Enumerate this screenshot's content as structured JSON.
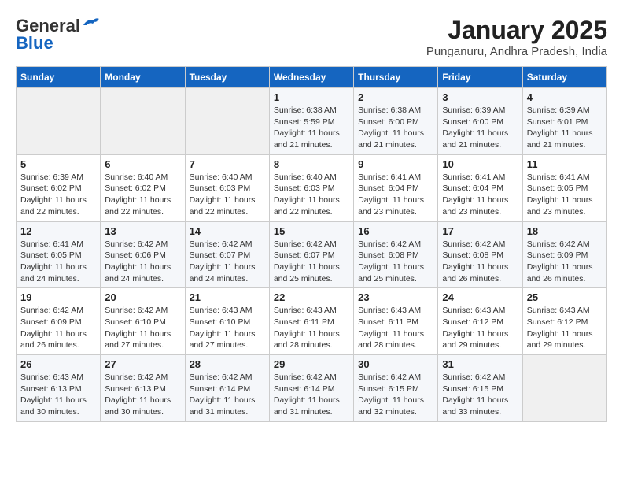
{
  "header": {
    "logo_general": "General",
    "logo_blue": "Blue",
    "month_title": "January 2025",
    "location": "Punganuru, Andhra Pradesh, India"
  },
  "weekdays": [
    "Sunday",
    "Monday",
    "Tuesday",
    "Wednesday",
    "Thursday",
    "Friday",
    "Saturday"
  ],
  "weeks": [
    [
      {
        "day": "",
        "info": ""
      },
      {
        "day": "",
        "info": ""
      },
      {
        "day": "",
        "info": ""
      },
      {
        "day": "1",
        "info": "Sunrise: 6:38 AM\nSunset: 5:59 PM\nDaylight: 11 hours and 21 minutes."
      },
      {
        "day": "2",
        "info": "Sunrise: 6:38 AM\nSunset: 6:00 PM\nDaylight: 11 hours and 21 minutes."
      },
      {
        "day": "3",
        "info": "Sunrise: 6:39 AM\nSunset: 6:00 PM\nDaylight: 11 hours and 21 minutes."
      },
      {
        "day": "4",
        "info": "Sunrise: 6:39 AM\nSunset: 6:01 PM\nDaylight: 11 hours and 21 minutes."
      }
    ],
    [
      {
        "day": "5",
        "info": "Sunrise: 6:39 AM\nSunset: 6:02 PM\nDaylight: 11 hours and 22 minutes."
      },
      {
        "day": "6",
        "info": "Sunrise: 6:40 AM\nSunset: 6:02 PM\nDaylight: 11 hours and 22 minutes."
      },
      {
        "day": "7",
        "info": "Sunrise: 6:40 AM\nSunset: 6:03 PM\nDaylight: 11 hours and 22 minutes."
      },
      {
        "day": "8",
        "info": "Sunrise: 6:40 AM\nSunset: 6:03 PM\nDaylight: 11 hours and 22 minutes."
      },
      {
        "day": "9",
        "info": "Sunrise: 6:41 AM\nSunset: 6:04 PM\nDaylight: 11 hours and 23 minutes."
      },
      {
        "day": "10",
        "info": "Sunrise: 6:41 AM\nSunset: 6:04 PM\nDaylight: 11 hours and 23 minutes."
      },
      {
        "day": "11",
        "info": "Sunrise: 6:41 AM\nSunset: 6:05 PM\nDaylight: 11 hours and 23 minutes."
      }
    ],
    [
      {
        "day": "12",
        "info": "Sunrise: 6:41 AM\nSunset: 6:05 PM\nDaylight: 11 hours and 24 minutes."
      },
      {
        "day": "13",
        "info": "Sunrise: 6:42 AM\nSunset: 6:06 PM\nDaylight: 11 hours and 24 minutes."
      },
      {
        "day": "14",
        "info": "Sunrise: 6:42 AM\nSunset: 6:07 PM\nDaylight: 11 hours and 24 minutes."
      },
      {
        "day": "15",
        "info": "Sunrise: 6:42 AM\nSunset: 6:07 PM\nDaylight: 11 hours and 25 minutes."
      },
      {
        "day": "16",
        "info": "Sunrise: 6:42 AM\nSunset: 6:08 PM\nDaylight: 11 hours and 25 minutes."
      },
      {
        "day": "17",
        "info": "Sunrise: 6:42 AM\nSunset: 6:08 PM\nDaylight: 11 hours and 26 minutes."
      },
      {
        "day": "18",
        "info": "Sunrise: 6:42 AM\nSunset: 6:09 PM\nDaylight: 11 hours and 26 minutes."
      }
    ],
    [
      {
        "day": "19",
        "info": "Sunrise: 6:42 AM\nSunset: 6:09 PM\nDaylight: 11 hours and 26 minutes."
      },
      {
        "day": "20",
        "info": "Sunrise: 6:42 AM\nSunset: 6:10 PM\nDaylight: 11 hours and 27 minutes."
      },
      {
        "day": "21",
        "info": "Sunrise: 6:43 AM\nSunset: 6:10 PM\nDaylight: 11 hours and 27 minutes."
      },
      {
        "day": "22",
        "info": "Sunrise: 6:43 AM\nSunset: 6:11 PM\nDaylight: 11 hours and 28 minutes."
      },
      {
        "day": "23",
        "info": "Sunrise: 6:43 AM\nSunset: 6:11 PM\nDaylight: 11 hours and 28 minutes."
      },
      {
        "day": "24",
        "info": "Sunrise: 6:43 AM\nSunset: 6:12 PM\nDaylight: 11 hours and 29 minutes."
      },
      {
        "day": "25",
        "info": "Sunrise: 6:43 AM\nSunset: 6:12 PM\nDaylight: 11 hours and 29 minutes."
      }
    ],
    [
      {
        "day": "26",
        "info": "Sunrise: 6:43 AM\nSunset: 6:13 PM\nDaylight: 11 hours and 30 minutes."
      },
      {
        "day": "27",
        "info": "Sunrise: 6:42 AM\nSunset: 6:13 PM\nDaylight: 11 hours and 30 minutes."
      },
      {
        "day": "28",
        "info": "Sunrise: 6:42 AM\nSunset: 6:14 PM\nDaylight: 11 hours and 31 minutes."
      },
      {
        "day": "29",
        "info": "Sunrise: 6:42 AM\nSunset: 6:14 PM\nDaylight: 11 hours and 31 minutes."
      },
      {
        "day": "30",
        "info": "Sunrise: 6:42 AM\nSunset: 6:15 PM\nDaylight: 11 hours and 32 minutes."
      },
      {
        "day": "31",
        "info": "Sunrise: 6:42 AM\nSunset: 6:15 PM\nDaylight: 11 hours and 33 minutes."
      },
      {
        "day": "",
        "info": ""
      }
    ]
  ]
}
